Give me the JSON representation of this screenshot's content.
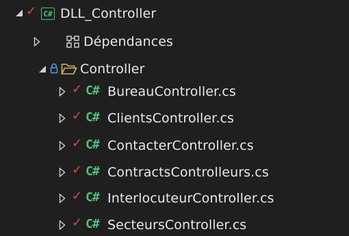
{
  "explorer": {
    "project": {
      "name": "DLL_Controller",
      "expanded": true,
      "icon": "csharp-project-icon",
      "status": "checked-in-icon"
    },
    "dependencies": {
      "label": "Dépendances",
      "expanded": false,
      "icon": "dependencies-icon"
    },
    "folder": {
      "label": "Controller",
      "expanded": true,
      "icon": "folder-open-icon",
      "lock": "lock-icon"
    },
    "files": [
      {
        "name": "BureauController.cs",
        "icon": "csharp-file-icon",
        "status": "checked-in-icon"
      },
      {
        "name": "ClientsController.cs",
        "icon": "csharp-file-icon",
        "status": "checked-in-icon"
      },
      {
        "name": "ContacterController.cs",
        "icon": "csharp-file-icon",
        "status": "checked-in-icon"
      },
      {
        "name": "ContractsControlleurs.cs",
        "icon": "csharp-file-icon",
        "status": "checked-in-icon"
      },
      {
        "name": "InterlocuteurController.cs",
        "icon": "csharp-file-icon",
        "status": "checked-in-icon"
      },
      {
        "name": "SecteursController.cs",
        "icon": "csharp-file-icon",
        "status": "checked-in-icon"
      }
    ],
    "glyphs": {
      "check": "✓",
      "csharp": "C#",
      "csharp_box": "C#"
    },
    "colors": {
      "background": "#1f1f1f",
      "text": "#e8e8e8",
      "check": "#e04a4a",
      "csharp": "#4ec27a",
      "folder": "#d9b45a",
      "lock": "#4aa3e8"
    }
  }
}
